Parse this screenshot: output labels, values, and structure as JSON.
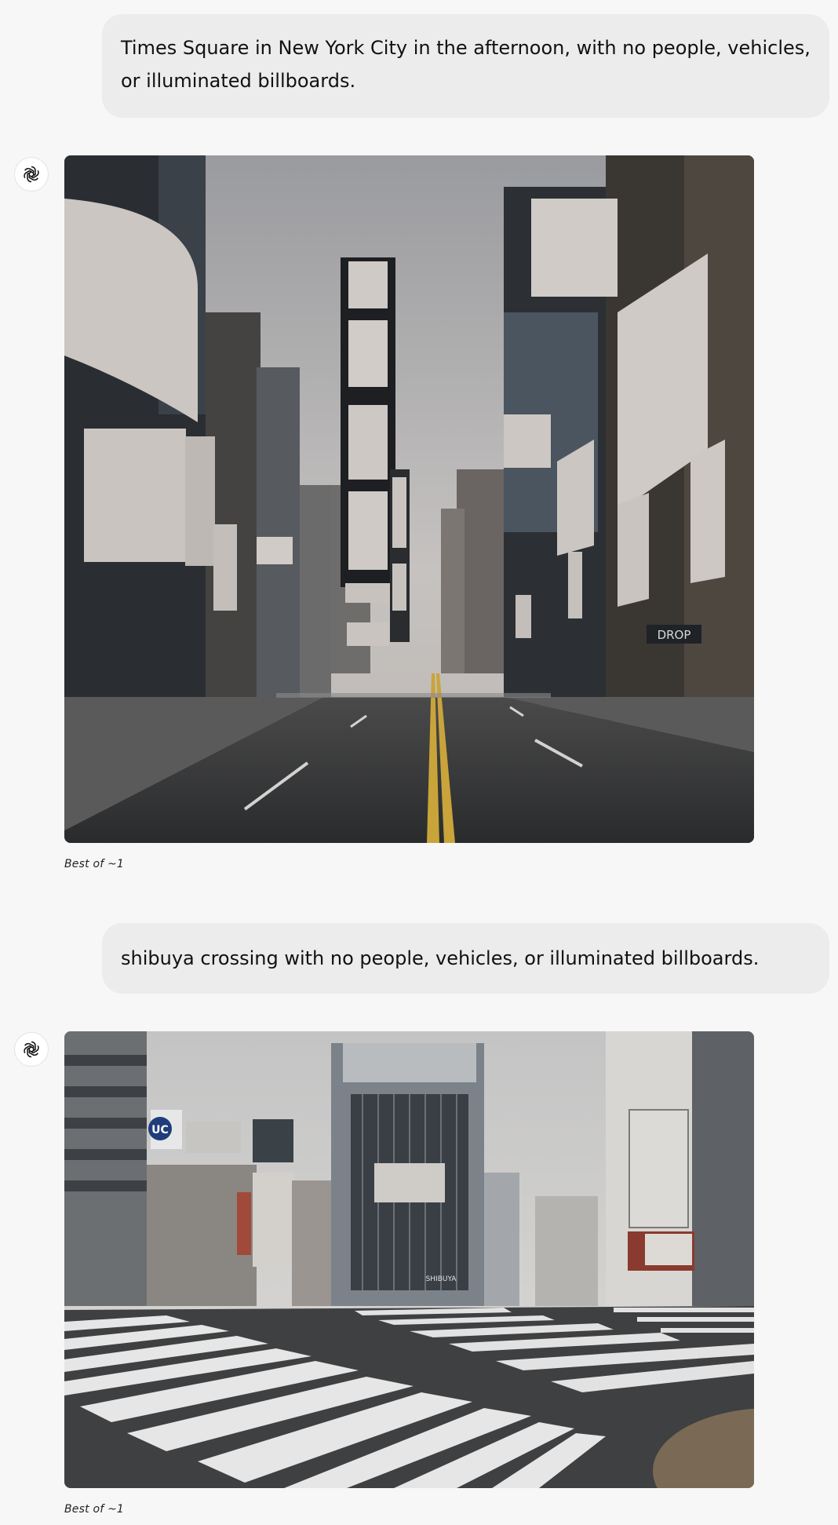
{
  "conversation": {
    "messages": [
      {
        "role": "user",
        "text": "Times Square in New York City in the afternoon, with no people, vehicles, or illuminated billboards."
      },
      {
        "role": "assistant",
        "avatar_icon": "openai-logo-icon",
        "image_subject": "times-square-empty",
        "caption": "Best of ~1"
      },
      {
        "role": "user",
        "text": "shibuya crossing with no people, vehicles, or illuminated billboards."
      },
      {
        "role": "assistant",
        "avatar_icon": "openai-logo-icon",
        "image_subject": "shibuya-crossing-empty",
        "caption": "Best of ~1"
      }
    ]
  },
  "image_texts": {
    "times_square_sign": "DROP",
    "shibuya_logo": "UC",
    "shibuya_storefront": "SHIBUYA"
  },
  "colors": {
    "page_bg": "#f7f7f7",
    "user_bubble_bg": "#ececec",
    "road_line_yellow": "#c9a43a"
  }
}
